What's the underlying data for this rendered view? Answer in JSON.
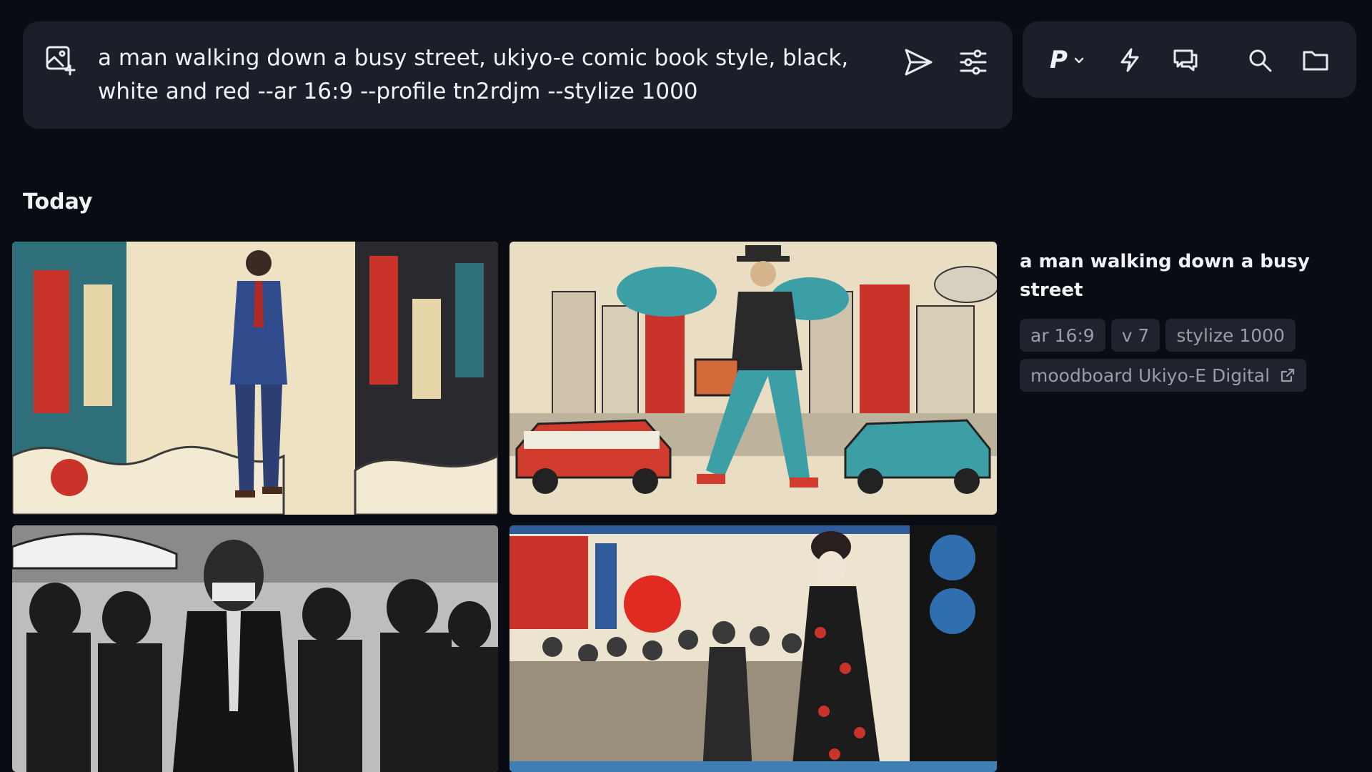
{
  "prompt": {
    "text": "a man walking down a busy street, ukiyo-e comic book style, black, white and red --ar 16:9 --profile tn2rdjm --stylize 1000"
  },
  "toolbar": {
    "personalize_label": "P"
  },
  "section": {
    "title": "Today"
  },
  "job": {
    "title": "a man walking down a busy street",
    "chips": [
      "ar 16:9",
      "v 7",
      "stylize 1000"
    ],
    "moodboard": "moodboard Ukiyo-E Digital"
  },
  "icons": {
    "add_image": "image-plus-icon",
    "send": "send-icon",
    "settings": "sliders-icon",
    "chevron": "chevron-down-icon",
    "speed": "lightning-icon",
    "chat": "chat-icon",
    "search": "search-icon",
    "folder": "folder-icon",
    "external": "external-link-icon"
  },
  "colors": {
    "background": "#0a0c14",
    "panel": "#1c1f29",
    "chip": "#20232d",
    "chip_text": "#9a9ca6",
    "accent_red": "#d43a2e",
    "accent_teal": "#2e9aa0"
  }
}
